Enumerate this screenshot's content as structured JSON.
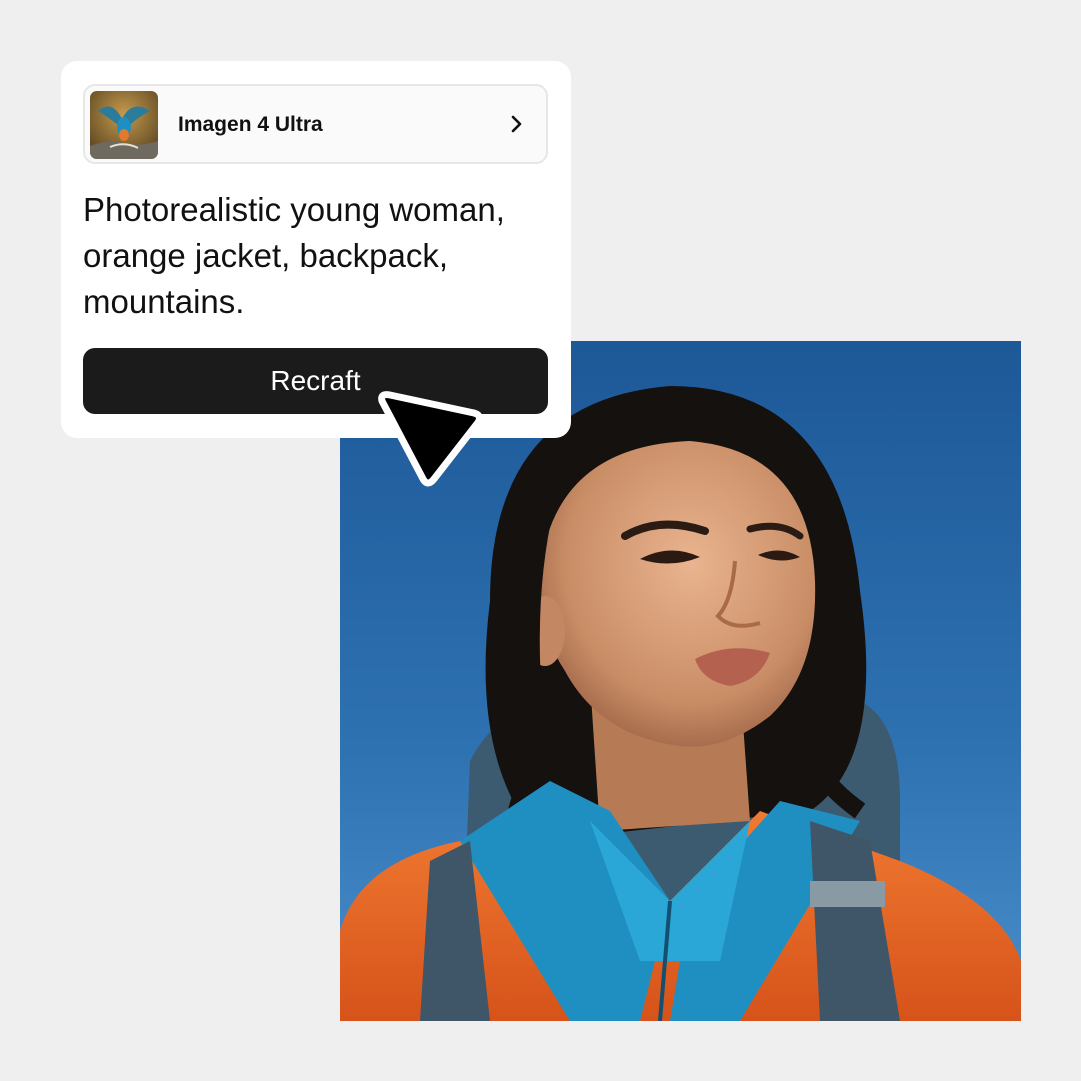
{
  "model_selector": {
    "name": "Imagen 4 Ultra",
    "thumbnail_icon": "kingfisher-thumbnail",
    "chevron_icon": "chevron-right-icon"
  },
  "prompt": {
    "text": "Photorealistic young woman, orange jacket, backpack, mountains."
  },
  "action": {
    "label": "Recraft"
  },
  "cursor_icon": "cursor-arrow-icon",
  "colors": {
    "background": "#efefef",
    "card": "#ffffff",
    "button": "#1b1b1b",
    "sky": "#2b6eae",
    "jacket": "#e8631f"
  }
}
